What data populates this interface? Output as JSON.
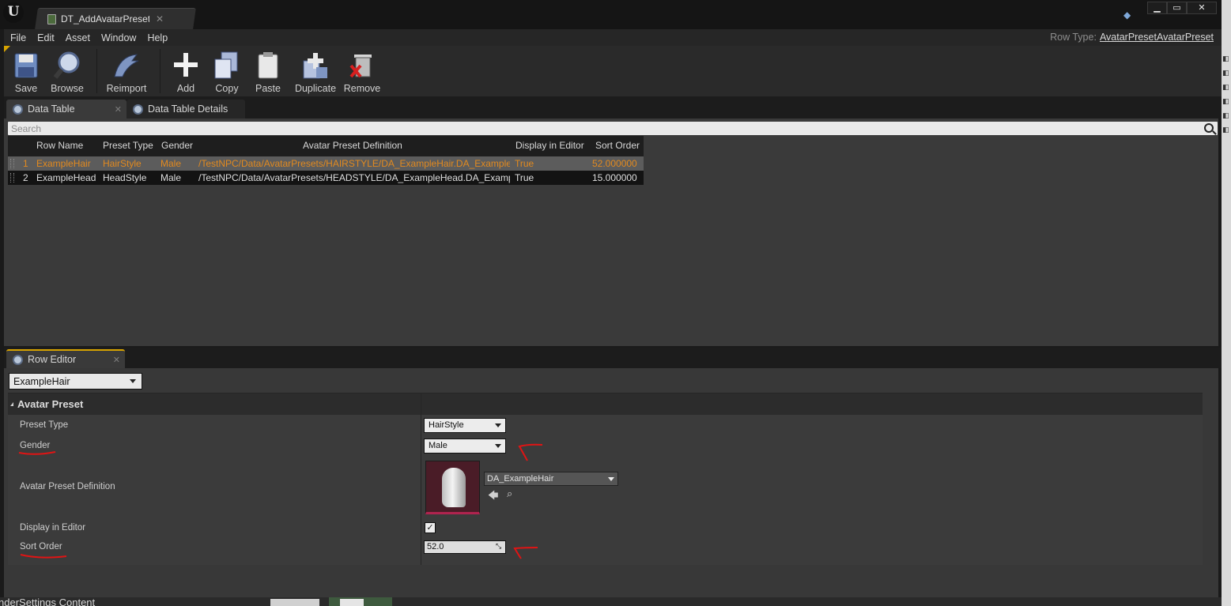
{
  "window": {
    "doc_tab_title": "DT_AddAvatarPresetPiece",
    "doc_tab_icon": "data-table-asset-icon",
    "controls": [
      "minimize-icon",
      "maximize-icon",
      "close-icon"
    ]
  },
  "menu": {
    "items": [
      "File",
      "Edit",
      "Asset",
      "Window",
      "Help"
    ],
    "row_type_label": "Row Type:",
    "row_type_value": "AvatarPresetAvatarPreset"
  },
  "toolbar": {
    "buttons": [
      {
        "label": "Save",
        "icon": "floppy-disk-icon"
      },
      {
        "label": "Browse",
        "icon": "magnifier-icon"
      },
      {
        "label": "Reimport",
        "icon": "reimport-arrow-icon"
      },
      {
        "label": "Add",
        "icon": "plus-icon"
      },
      {
        "label": "Copy",
        "icon": "copy-icon"
      },
      {
        "label": "Paste",
        "icon": "clipboard-icon"
      },
      {
        "label": "Duplicate",
        "icon": "duplicate-icon"
      },
      {
        "label": "Remove",
        "icon": "trash-icon"
      }
    ]
  },
  "tabs": {
    "data_table": "Data Table",
    "data_table_details": "Data Table Details",
    "row_editor": "Row Editor"
  },
  "search": {
    "placeholder": "Search"
  },
  "table": {
    "headers": [
      "Row Name",
      "Preset Type",
      "Gender",
      "Avatar Preset Definition",
      "Display in Editor",
      "Sort Order"
    ],
    "rows": [
      {
        "index": "1",
        "row_name": "ExampleHair",
        "preset_type": "HairStyle",
        "gender": "Male",
        "definition": "/TestNPC/Data/AvatarPresets/HAIRSTYLE/DA_ExampleHair.DA_Example",
        "display": "True",
        "sort": "52.000000",
        "selected": true
      },
      {
        "index": "2",
        "row_name": "ExampleHead",
        "preset_type": "HeadStyle",
        "gender": "Male",
        "definition": "/TestNPC/Data/AvatarPresets/HEADSTYLE/DA_ExampleHead.DA_Examp",
        "display": "True",
        "sort": "15.000000",
        "selected": false
      }
    ]
  },
  "row_editor": {
    "selected_row": "ExampleHair",
    "category": "Avatar Preset",
    "props": {
      "preset_type_label": "Preset Type",
      "preset_type_value": "HairStyle",
      "gender_label": "Gender",
      "gender_value": "Male",
      "definition_label": "Avatar Preset Definition",
      "definition_value": "DA_ExampleHair",
      "display_label": "Display in Editor",
      "display_checked": true,
      "sort_label": "Sort Order",
      "sort_value": "52.0"
    }
  },
  "bottom": {
    "partial_text": "nderSettings Content"
  },
  "colors": {
    "selected_row_text": "#e28a1f",
    "annotation_red": "#e01414",
    "panel_bg": "#3a3a3a"
  }
}
